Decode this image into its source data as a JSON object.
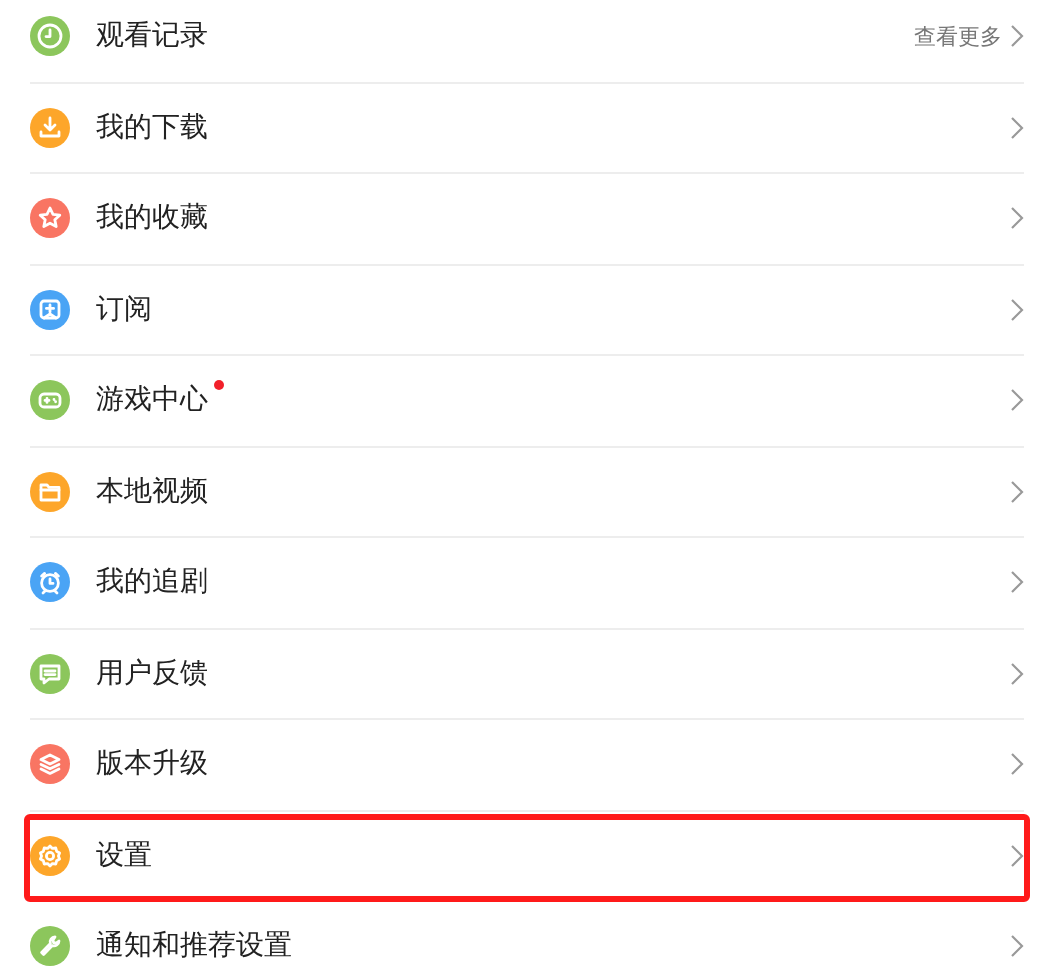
{
  "menu": [
    {
      "label": "观看记录",
      "color": "#8cc65c",
      "more": "查看更多",
      "dot": false,
      "highlighted": false
    },
    {
      "label": "我的下载",
      "color": "#fda62a",
      "dot": false,
      "highlighted": false
    },
    {
      "label": "我的收藏",
      "color": "#f97563",
      "dot": false,
      "highlighted": false
    },
    {
      "label": "订阅",
      "color": "#4aa4f5",
      "dot": false,
      "highlighted": false
    },
    {
      "label": "游戏中心",
      "color": "#8cc65c",
      "dot": true,
      "highlighted": false
    },
    {
      "label": "本地视频",
      "color": "#fda62a",
      "dot": false,
      "highlighted": false
    },
    {
      "label": "我的追剧",
      "color": "#4aa4f5",
      "dot": false,
      "highlighted": false
    },
    {
      "label": "用户反馈",
      "color": "#8cc65c",
      "dot": false,
      "highlighted": false
    },
    {
      "label": "版本升级",
      "color": "#f97563",
      "dot": false,
      "highlighted": false
    },
    {
      "label": "设置",
      "color": "#fda62a",
      "dot": false,
      "highlighted": true
    },
    {
      "label": "通知和推荐设置",
      "color": "#8cc65c",
      "dot": false,
      "highlighted": false
    }
  ]
}
